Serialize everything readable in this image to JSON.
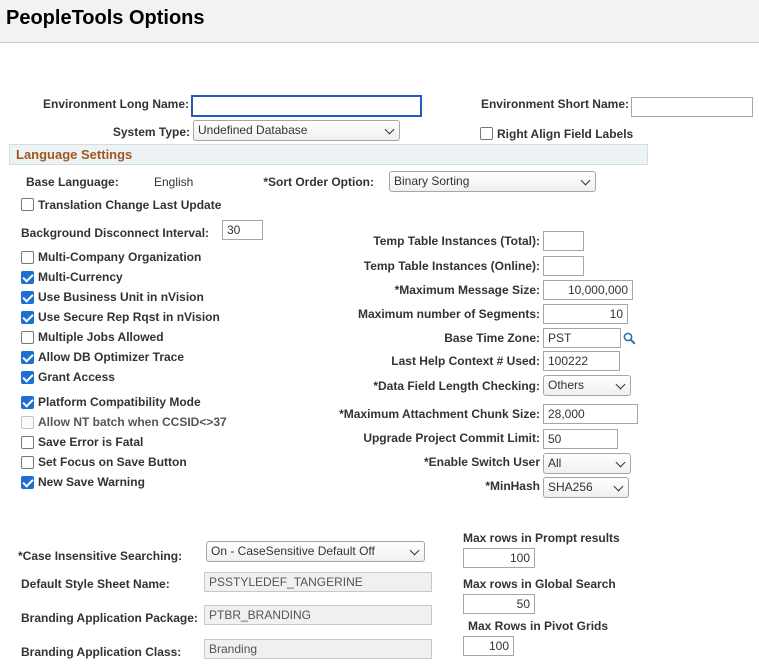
{
  "page": {
    "title": "PeopleTools Options"
  },
  "top": {
    "env_long_name_label": "Environment Long Name:",
    "env_long_name_value": "",
    "env_short_name_label": "Environment Short Name:",
    "env_short_name_value": "",
    "system_type_label": "System Type:",
    "system_type_value": "Undefined Database",
    "right_align_label": "Right Align Field Labels",
    "right_align_checked": false
  },
  "language": {
    "section_title": "Language Settings",
    "base_language_label": "Base Language:",
    "base_language_value": "English",
    "sort_order_label": "*Sort Order Option:",
    "sort_order_value": "Binary Sorting",
    "translation_change_label": "Translation Change Last Update",
    "background_disconnect_label": "Background Disconnect Interval:",
    "background_disconnect_value": "30"
  },
  "options": [
    {
      "label": "Multi-Company Organization",
      "checked": false,
      "disabled": false
    },
    {
      "label": "Multi-Currency",
      "checked": true,
      "disabled": false
    },
    {
      "label": "Use Business Unit in nVision",
      "checked": true,
      "disabled": false
    },
    {
      "label": "Use Secure Rep Rqst in nVision",
      "checked": true,
      "disabled": false
    },
    {
      "label": "Multiple Jobs Allowed",
      "checked": false,
      "disabled": false
    },
    {
      "label": "Allow DB Optimizer Trace",
      "checked": true,
      "disabled": false
    },
    {
      "label": "Grant Access",
      "checked": true,
      "disabled": false
    },
    {
      "label": "Platform Compatibility Mode",
      "checked": true,
      "disabled": false
    },
    {
      "label": "Allow NT batch when CCSID<>37",
      "checked": false,
      "disabled": true
    },
    {
      "label": "Save Error is Fatal",
      "checked": false,
      "disabled": false
    },
    {
      "label": "Set Focus on Save Button",
      "checked": false,
      "disabled": false
    },
    {
      "label": "New Save Warning",
      "checked": true,
      "disabled": false
    }
  ],
  "right_fields": {
    "temp_total_label": "Temp Table Instances (Total):",
    "temp_total_value": "",
    "temp_online_label": "Temp Table Instances (Online):",
    "temp_online_value": "",
    "max_msg_size_label": "*Maximum Message Size:",
    "max_msg_size_value": "10,000,000",
    "max_segments_label": "Maximum number of Segments:",
    "max_segments_value": "10",
    "base_tz_label": "Base Time Zone:",
    "base_tz_value": "PST",
    "last_help_label": "Last Help Context # Used:",
    "last_help_value": "100222",
    "data_field_label": "*Data Field Length Checking:",
    "data_field_value": "Others",
    "max_attach_label": "*Maximum Attachment Chunk Size:",
    "max_attach_value": "28,000",
    "upgrade_commit_label": "Upgrade Project Commit Limit:",
    "upgrade_commit_value": "50",
    "enable_switch_label": "*Enable Switch User",
    "enable_switch_value": "All",
    "minhash_label": "*MinHash",
    "minhash_value": "SHA256"
  },
  "bottom": {
    "case_insensitive_label": "*Case Insensitive Searching:",
    "case_insensitive_value": "On - CaseSensitive Default Off",
    "style_sheet_label": "Default Style Sheet Name:",
    "style_sheet_value": "PSSTYLEDEF_TANGERINE",
    "branding_pkg_label": "Branding Application Package:",
    "branding_pkg_value": "PTBR_BRANDING",
    "branding_class_label": "Branding Application Class:",
    "branding_class_value": "Branding",
    "max_prompt_label": "Max rows in Prompt results",
    "max_prompt_value": "100",
    "max_global_label": "Max rows in Global Search",
    "max_global_value": "50",
    "max_pivot_label": "Max Rows in Pivot Grids",
    "max_pivot_value": "100"
  },
  "colors": {
    "section_title": "#a0571f",
    "checkbox_checked": "#1f6fd1",
    "focus_border": "#1f5fb8"
  },
  "icons": {
    "lookup": "magnifier-icon",
    "dropdown": "chevron-down-icon"
  }
}
